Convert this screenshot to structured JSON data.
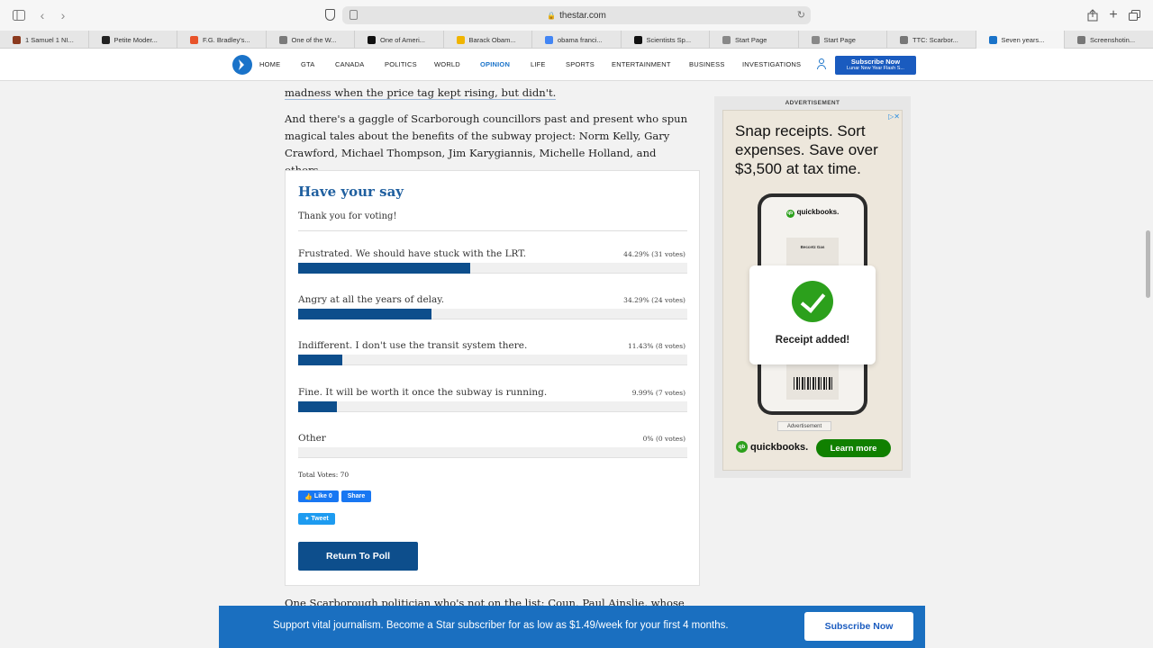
{
  "browser": {
    "url": "thestar.com",
    "tabs": [
      {
        "label": "1 Samuel 1 NI...",
        "color": "#8b3a1e"
      },
      {
        "label": "Petite Moder...",
        "color": "#222222"
      },
      {
        "label": "F.G. Bradley's...",
        "color": "#e8532a"
      },
      {
        "label": "One of the W...",
        "color": "#7a7a7a"
      },
      {
        "label": "One of Ameri...",
        "color": "#111111"
      },
      {
        "label": "Barack Obam...",
        "color": "#f0b400"
      },
      {
        "label": "obama franci...",
        "color": "#4285f4"
      },
      {
        "label": "Scientists Sp...",
        "color": "#111111"
      },
      {
        "label": "Start Page",
        "color": "#888888"
      },
      {
        "label": "Start Page",
        "color": "#888888"
      },
      {
        "label": "TTC: Scarbor...",
        "color": "#777777"
      },
      {
        "label": "Seven years...",
        "color": "#1a73c9"
      },
      {
        "label": "Screenshotin...",
        "color": "#777777"
      }
    ],
    "active_tab": 11
  },
  "header": {
    "nav": [
      "HOME",
      "GTA",
      "CANADA",
      "POLITICS",
      "WORLD",
      "OPINION",
      "LIFE",
      "SPORTS",
      "ENTERTAINMENT",
      "BUSINESS",
      "INVESTIGATIONS"
    ],
    "active_nav": "OPINION",
    "subscribe_line1": "Subscribe Now",
    "subscribe_line2": "Lunar New Year Flash S..."
  },
  "article": {
    "para_top": "madness when the price tag kept rising, but didn't.",
    "para_mid": "And there's a gaggle of Scarborough councillors past and present who spun magical tales about the benefits of the subway project: Norm Kelly, Gary Crawford, Michael Thompson, Jim Karygiannis, Michelle Holland, and others.",
    "para_bottom": "One Scarborough politician who's not on the list: Coun. Paul Ainslie, whose"
  },
  "poll": {
    "title": "Have your say",
    "thanks": "Thank you for voting!",
    "options": [
      {
        "label": "Frustrated. We should have stuck with the LRT.",
        "stat": "44.29%  (31 votes)",
        "percent": 44.29
      },
      {
        "label": "Angry at all the years of delay.",
        "stat": "34.29%  (24 votes)",
        "percent": 34.29
      },
      {
        "label": "Indifferent. I don't use the transit system there.",
        "stat": "11.43%  (8 votes)",
        "percent": 11.43
      },
      {
        "label": "Fine. It will be worth it once the subway is running.",
        "stat": "9.99%  (7 votes)",
        "percent": 9.99
      },
      {
        "label": "Other",
        "stat": "0%  (0 votes)",
        "percent": 0
      }
    ],
    "total": "Total Votes: 70",
    "like": "Like 0",
    "share": "Share",
    "tweet": "Tweet",
    "return": "Return To Poll"
  },
  "ad": {
    "label": "ADVERTISEMENT",
    "headline": "Snap receipts. Sort expenses. Save over $3,500 at tax time.",
    "phone_brand": "quickbooks.",
    "receipt_name": "Beccetz Gas",
    "card_text": "Receipt added!",
    "small_label": "Advertisement",
    "brand": "quickbooks.",
    "cta": "Learn more",
    "accent": "#2ca01c"
  },
  "banner": {
    "text": "Support vital journalism. Become a Star subscriber for as low as $1.49/week for your first 4 months.",
    "button": "Subscribe Now"
  }
}
